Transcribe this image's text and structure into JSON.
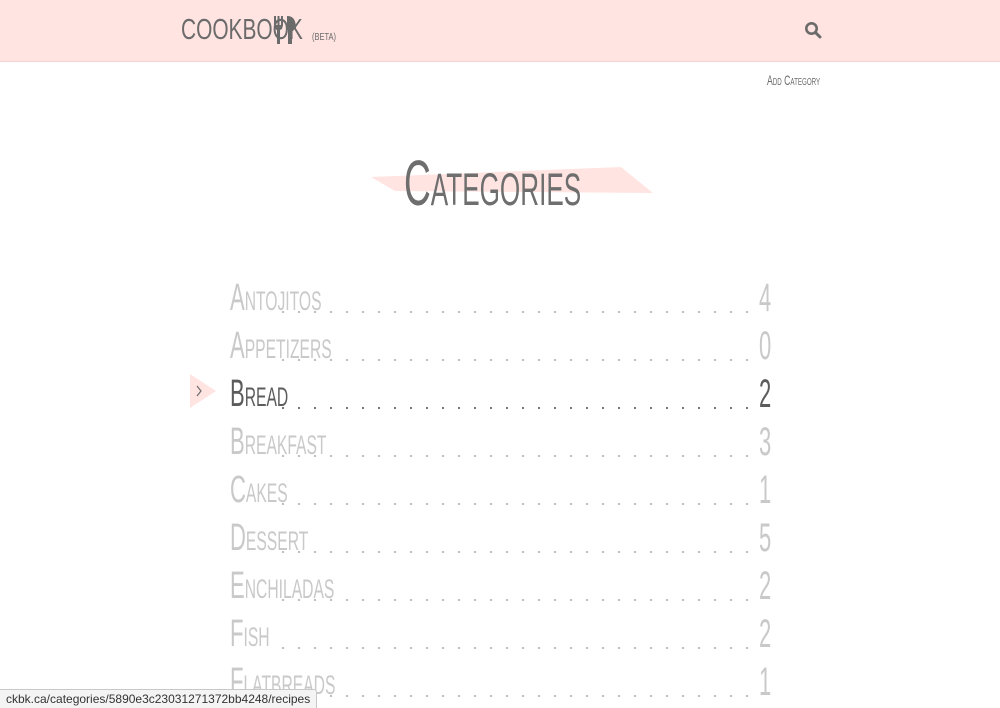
{
  "header": {
    "brand_name": "COOKBOOK",
    "brand_icon": "fork-knife-icon",
    "beta_label": "(BETA)",
    "search_icon": "search-icon",
    "background_color": "#ffe4e2"
  },
  "actions": {
    "add_category_label": "Add Category"
  },
  "page": {
    "title": "Categories",
    "accent_color": "#ffe4e2",
    "active_color": "#5c5c5c",
    "inactive_color": "#c9c9c9"
  },
  "categories": [
    {
      "name": "Antojitos",
      "count": "4"
    },
    {
      "name": "Appetizers",
      "count": "0"
    },
    {
      "name": "Bread",
      "count": "2",
      "active": true
    },
    {
      "name": "Breakfast",
      "count": "3"
    },
    {
      "name": "Cakes",
      "count": "1"
    },
    {
      "name": "Dessert",
      "count": "5"
    },
    {
      "name": "Enchiladas",
      "count": "2"
    },
    {
      "name": "Fish",
      "count": "2"
    },
    {
      "name": "Flatbreads",
      "count": "1"
    }
  ],
  "status_bar": {
    "url": "ckbk.ca/categories/5890e3c23031271372bb4248/recipes"
  }
}
